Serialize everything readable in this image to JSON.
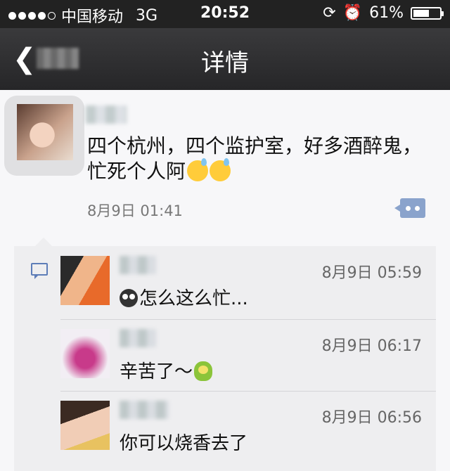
{
  "status_bar": {
    "carrier": "中国移动",
    "network": "3G",
    "time": "20:52",
    "battery_text": "61%",
    "battery_level": 0.61,
    "signal_bars_filled": 4,
    "icons": [
      "rotation-lock-icon",
      "alarm-icon"
    ]
  },
  "nav": {
    "title": "详情",
    "back_icon": "chevron-left-icon"
  },
  "post": {
    "text": "四个杭州，四个监护室，好多酒醉鬼，忙死个人阿",
    "emoji_count": 2,
    "time": "8月9日 01:41"
  },
  "comments": [
    {
      "time": "8月9日 05:59",
      "text": "怎么这么忙...",
      "emoji": "owl"
    },
    {
      "time": "8月9日 06:17",
      "text": "辛苦了〜",
      "emoji": "frog"
    },
    {
      "time": "8月9日 06:56",
      "text": "你可以烧香去了",
      "emoji": ""
    }
  ],
  "colors": {
    "nav_bg": "#2e2e30",
    "link_blue": "#5d7db8",
    "comment_bg": "#eeeef0"
  }
}
